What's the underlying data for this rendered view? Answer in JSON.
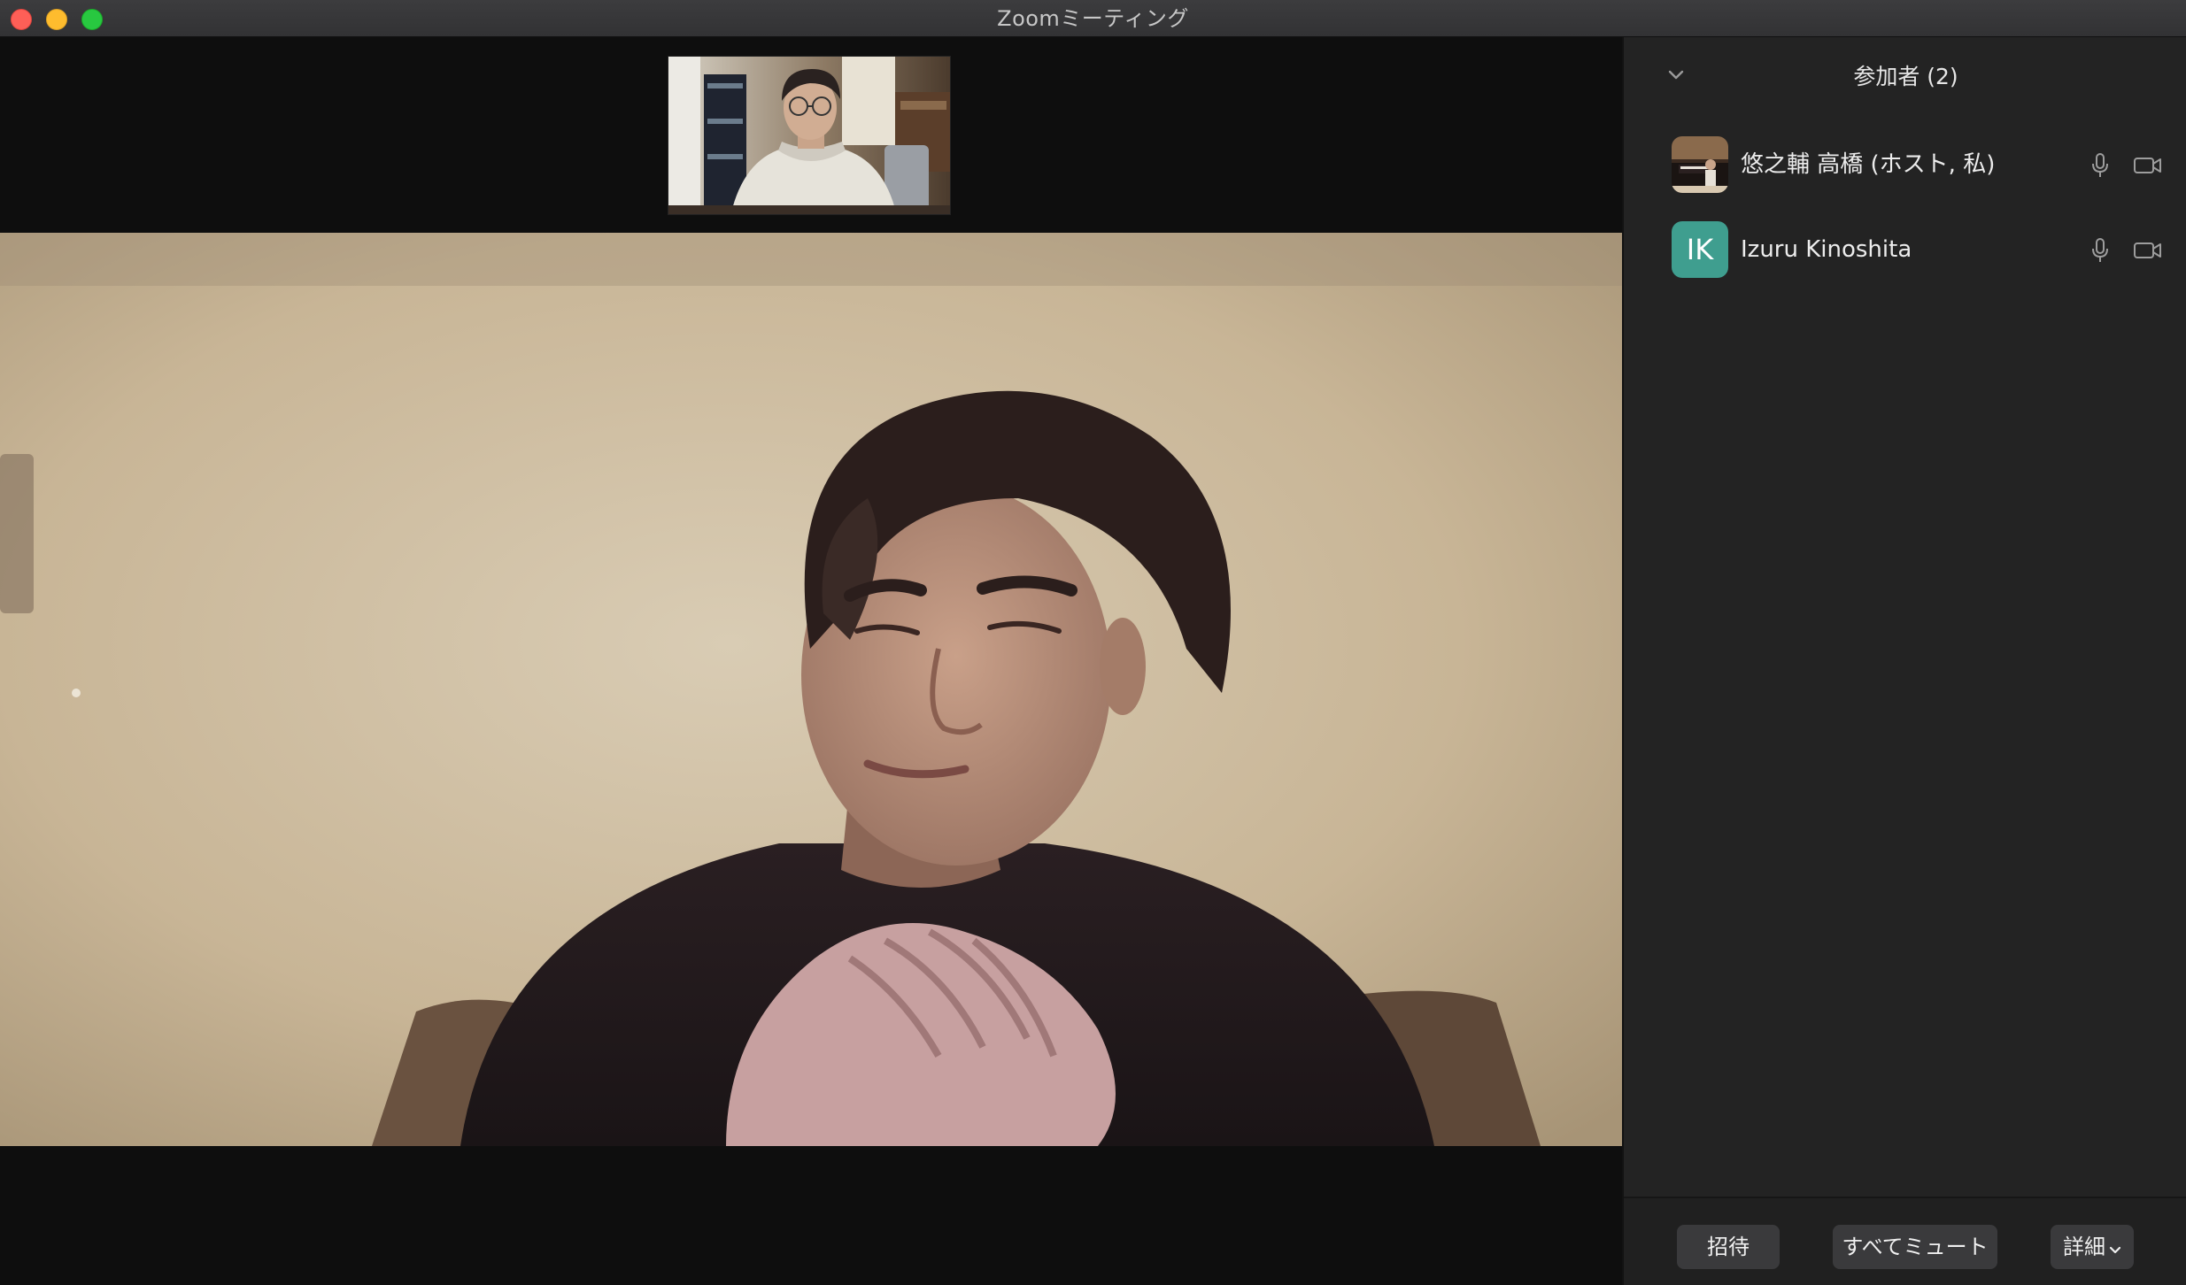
{
  "window": {
    "title": "Zoomミーティング"
  },
  "participants_panel": {
    "title": "参加者 (2)",
    "participants": [
      {
        "name": "悠之輔 高橋 (ホスト, 私)",
        "avatar_type": "photo",
        "mic": "mic-icon",
        "video": "video-camera-icon"
      },
      {
        "name": "Izuru Kinoshita",
        "avatar_type": "initials",
        "initials": "IK",
        "avatar_color": "#3f9e8f",
        "mic": "mic-icon",
        "video": "video-camera-icon"
      }
    ],
    "footer": {
      "invite_label": "招待",
      "mute_all_label": "すべてミュート",
      "more_label": "詳細"
    }
  },
  "colors": {
    "titlebar": "#3c3c3e",
    "panel_bg": "#232323",
    "video_bg": "#0e0e0e",
    "button_bg": "#3a3a3c",
    "traffic_close": "#fe5f57",
    "traffic_minimize": "#febc2e",
    "traffic_zoom": "#28c840"
  }
}
